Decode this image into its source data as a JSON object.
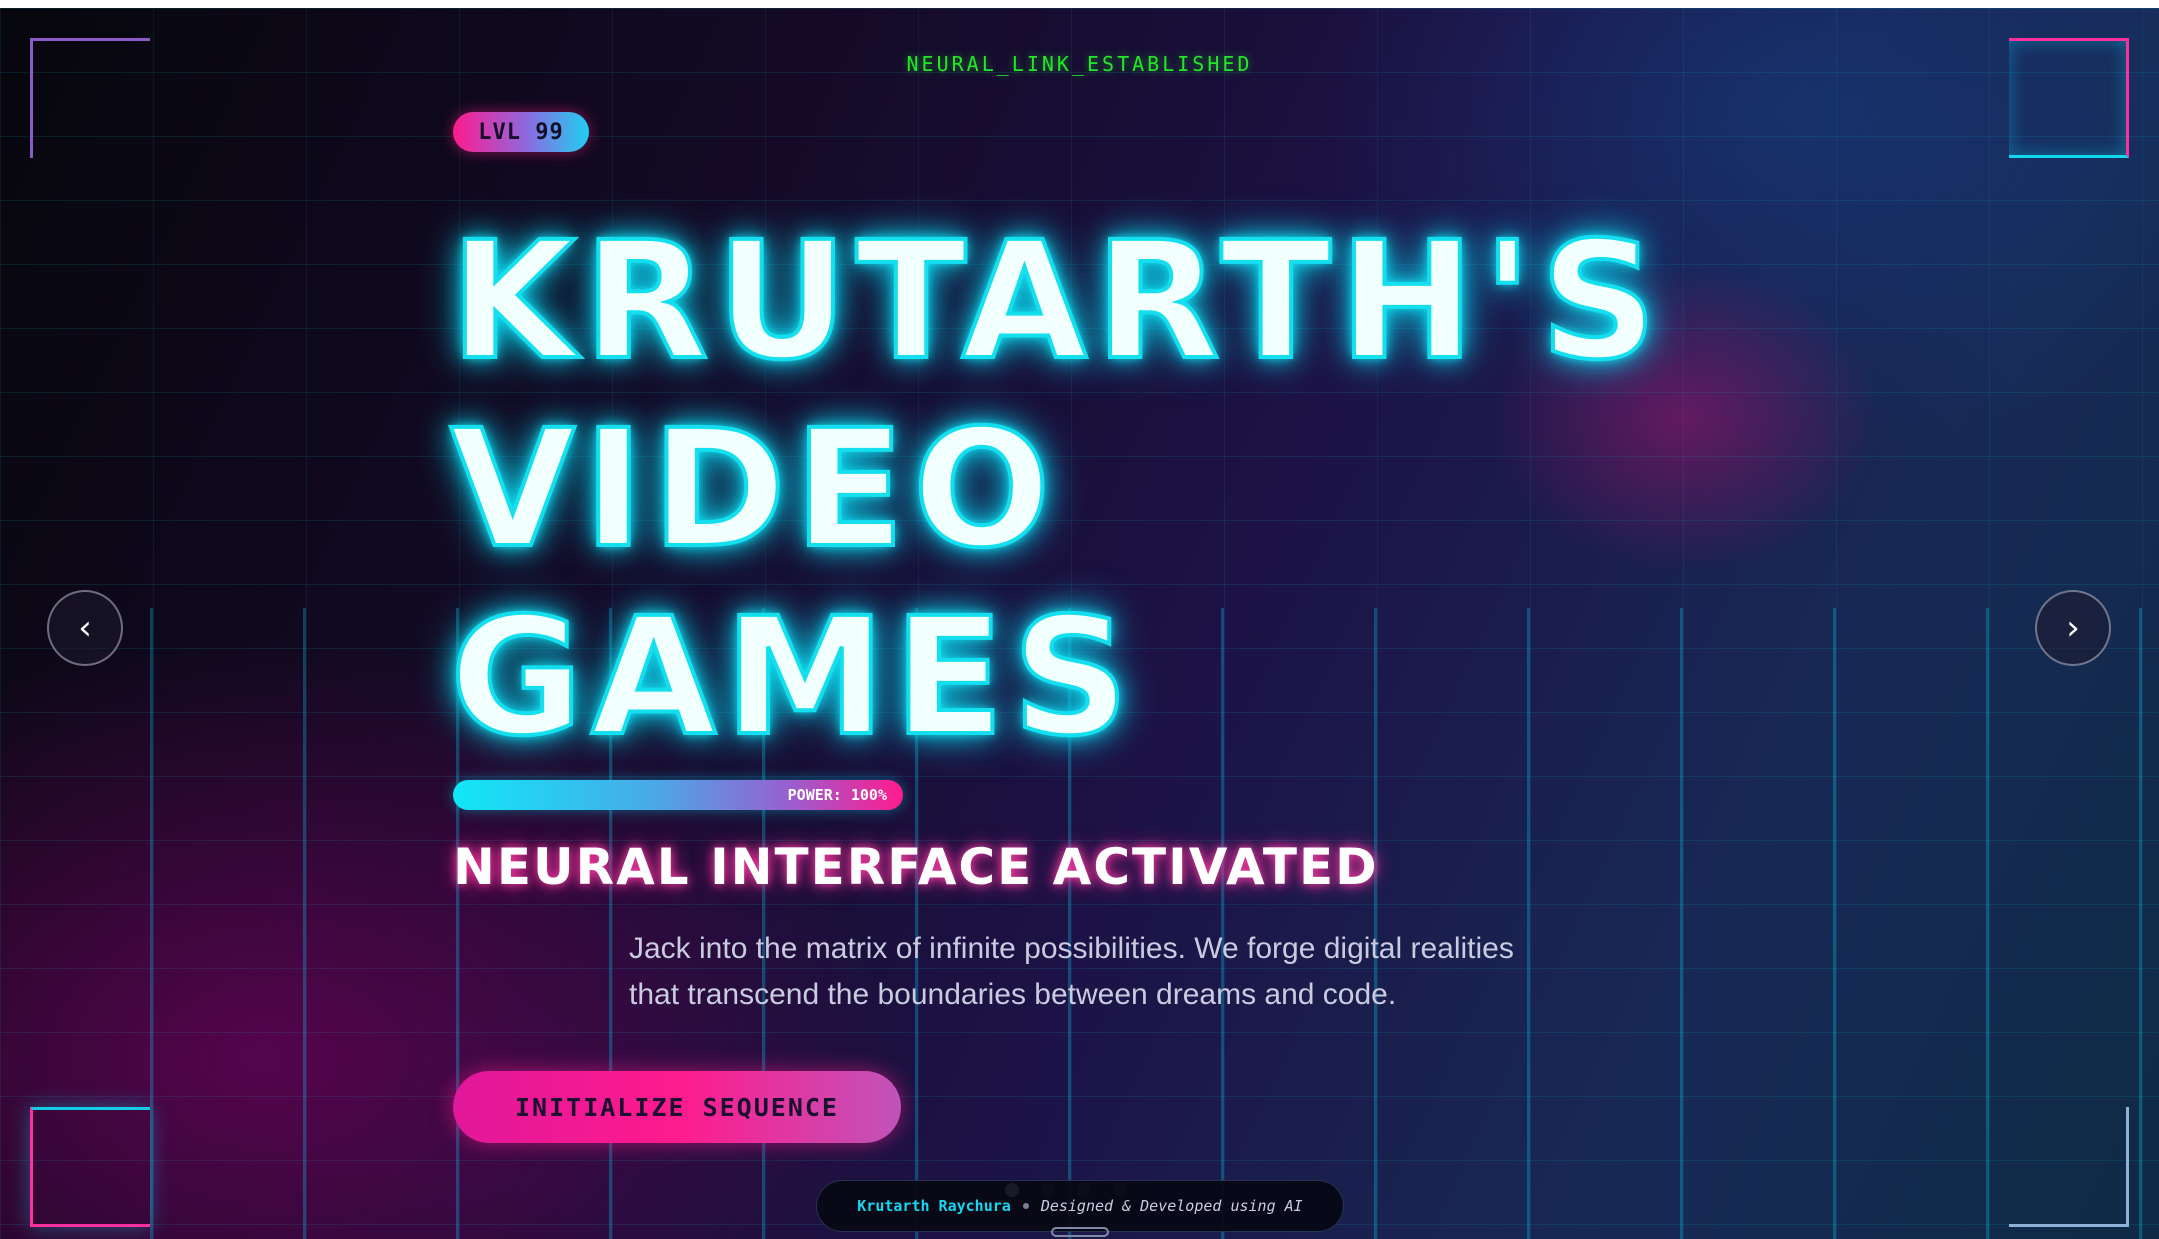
{
  "status_text": "NEURAL_LINK_ESTABLISHED",
  "level_badge": "LVL 99",
  "title_lines": [
    "KRUTARTH'S",
    "VIDEO",
    "GAMES"
  ],
  "power": {
    "label": "POWER: 100%",
    "value": 1.0
  },
  "subtitle": "NEURAL INTERFACE ACTIVATED",
  "description": "Jack into the matrix of infinite possibilities. We forge digital realities that transcend the boundaries between dreams and code.",
  "cta_label": "INITIALIZE SEQUENCE",
  "carousel": {
    "prev_label": "‹",
    "next_label": "›",
    "slide_count": 4,
    "active_index": 0
  },
  "footer": {
    "name": "Krutarth Raychura",
    "credit": "Designed & Developed using AI"
  },
  "colors": {
    "cyan": "#13e6f4",
    "magenta": "#ff1b8d",
    "status_green": "#23e629",
    "footer_name": "#19d6ef"
  }
}
